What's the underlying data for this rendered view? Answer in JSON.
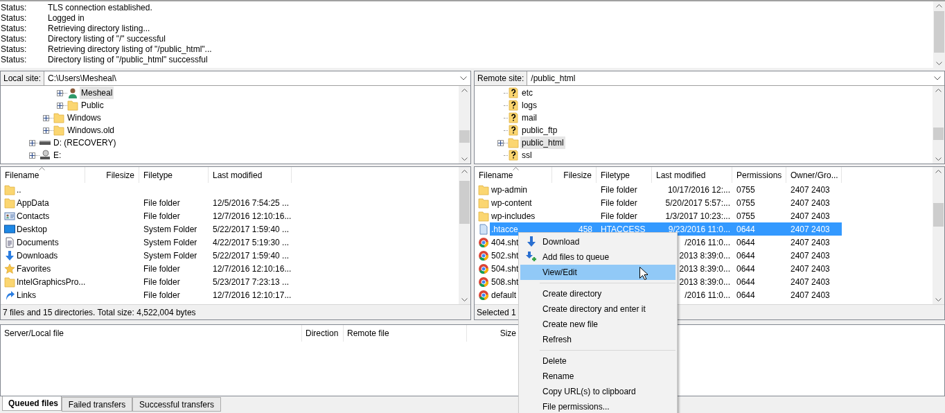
{
  "message_log": [
    {
      "label": "Status:",
      "message": "TLS connection established."
    },
    {
      "label": "Status:",
      "message": "Logged in"
    },
    {
      "label": "Status:",
      "message": "Retrieving directory listing..."
    },
    {
      "label": "Status:",
      "message": "Directory listing of \"/\" successful"
    },
    {
      "label": "Status:",
      "message": "Retrieving directory listing of \"/public_html\"..."
    },
    {
      "label": "Status:",
      "message": "Directory listing of \"/public_html\" successful"
    }
  ],
  "local": {
    "site_label": "Local site:",
    "path": "C:\\Users\\Mesheal\\",
    "tree": [
      {
        "children": [
          {
            "children": [
              {
                "label": "Mesheal",
                "kind": "user",
                "expandable": true,
                "expanded": false,
                "selected": true
              },
              {
                "label": "Public",
                "kind": "folder",
                "expandable": true,
                "expanded": false,
                "selected": false
              }
            ]
          },
          {
            "label": "Windows",
            "kind": "folder",
            "expandable": true,
            "expanded": false,
            "selected": false
          },
          {
            "label": "Windows.old",
            "kind": "folder",
            "expandable": true,
            "expanded": false,
            "selected": false
          }
        ]
      },
      {
        "label": "D: (RECOVERY)",
        "kind": "drive",
        "expandable": true,
        "expanded": false,
        "selected": false
      },
      {
        "label": "E:",
        "kind": "disc",
        "expandable": true,
        "expanded": false,
        "selected": false
      }
    ],
    "columns": [
      "Filename",
      "Filesize",
      "Filetype",
      "Last modified"
    ],
    "rows": [
      {
        "kind": "folder",
        "name": "..",
        "filetype": "",
        "modified": "",
        "selected": false
      },
      {
        "kind": "folder",
        "name": "AppData",
        "filetype": "File folder",
        "modified": "12/5/2016 7:54:25 ...",
        "selected": false
      },
      {
        "kind": "contacts",
        "name": "Contacts",
        "filetype": "File folder",
        "modified": "12/7/2016 12:10:16...",
        "selected": false
      },
      {
        "kind": "desktop",
        "name": "Desktop",
        "filetype": "System Folder",
        "modified": "5/22/2017 1:59:40 ...",
        "selected": false
      },
      {
        "kind": "documents",
        "name": "Documents",
        "filetype": "System Folder",
        "modified": "4/22/2017 5:19:30 ...",
        "selected": false
      },
      {
        "kind": "downloads",
        "name": "Downloads",
        "filetype": "System Folder",
        "modified": "5/22/2017 1:59:40 ...",
        "selected": false
      },
      {
        "kind": "favorites",
        "name": "Favorites",
        "filetype": "File folder",
        "modified": "12/7/2016 12:10:16...",
        "selected": false
      },
      {
        "kind": "folder",
        "name": "IntelGraphicsPro...",
        "filetype": "File folder",
        "modified": "5/23/2017 7:23:13 ...",
        "selected": false
      },
      {
        "kind": "links",
        "name": "Links",
        "filetype": "File folder",
        "modified": "12/7/2016 12:10:17...",
        "selected": false
      }
    ],
    "status": "7 files and 15 directories. Total size: 4,522,004 bytes"
  },
  "remote": {
    "site_label": "Remote site:",
    "path": "/public_html",
    "tree": [
      {
        "children": [
          {
            "label": "etc",
            "kind": "unknown",
            "expandable": false,
            "selected": false
          },
          {
            "label": "logs",
            "kind": "unknown",
            "expandable": false,
            "selected": false
          },
          {
            "label": "mail",
            "kind": "unknown",
            "expandable": false,
            "selected": false
          },
          {
            "label": "public_ftp",
            "kind": "unknown",
            "expandable": false,
            "selected": false
          },
          {
            "label": "public_html",
            "kind": "folder",
            "expandable": true,
            "expanded": false,
            "selected": true
          },
          {
            "label": "ssl",
            "kind": "unknown",
            "expandable": false,
            "selected": false
          }
        ]
      }
    ],
    "columns": [
      "Filename",
      "Filesize",
      "Filetype",
      "Last modified",
      "Permissions",
      "Owner/Gro..."
    ],
    "rows": [
      {
        "kind": "folder",
        "name": "wp-admin",
        "filesize": "",
        "filetype": "File folder",
        "modified": "10/17/2016 12:...",
        "permissions": "0755",
        "owner": "2407 2403",
        "selected": false
      },
      {
        "kind": "folder",
        "name": "wp-content",
        "filesize": "",
        "filetype": "File folder",
        "modified": "5/20/2017 5:57:...",
        "permissions": "0755",
        "owner": "2407 2403",
        "selected": false
      },
      {
        "kind": "folder",
        "name": "wp-includes",
        "filesize": "",
        "filetype": "File folder",
        "modified": "1/3/2017 10:23:...",
        "permissions": "0755",
        "owner": "2407 2403",
        "selected": false
      },
      {
        "kind": "file",
        "name": ".htacce",
        "filesize": "458",
        "filetype": "HTACCESS",
        "modified": "9/23/2016 11:0...",
        "permissions": "0644",
        "owner": "2407 2403",
        "selected": true
      },
      {
        "kind": "web",
        "name": "404.sht",
        "filesize": "",
        "filetype": "",
        "modified": "/2016 11:0...",
        "permissions": "0644",
        "owner": "2407 2403",
        "selected": false
      },
      {
        "kind": "web",
        "name": "502.sht",
        "filesize": "",
        "filetype": "",
        "modified": "2013 8:39:0...",
        "permissions": "0644",
        "owner": "2407 2403",
        "selected": false
      },
      {
        "kind": "web",
        "name": "504.sht",
        "filesize": "",
        "filetype": "",
        "modified": "2013 8:39:0...",
        "permissions": "0644",
        "owner": "2407 2403",
        "selected": false
      },
      {
        "kind": "web",
        "name": "508.sht",
        "filesize": "",
        "filetype": "",
        "modified": "2013 8:39:0...",
        "permissions": "0644",
        "owner": "2407 2403",
        "selected": false
      },
      {
        "kind": "web",
        "name": "default",
        "filesize": "",
        "filetype": "",
        "modified": "/2016 11:0...",
        "permissions": "0644",
        "owner": "2407 2403",
        "selected": false
      }
    ],
    "status": "Selected 1"
  },
  "queue": {
    "columns": [
      "Server/Local file",
      "Direction",
      "Remote file",
      "Size"
    ],
    "tabs": [
      {
        "label": "Queued files",
        "selected": true
      },
      {
        "label": "Failed transfers",
        "selected": false
      },
      {
        "label": "Successful transfers",
        "selected": false
      }
    ]
  },
  "context_menu": [
    [
      {
        "kind": "download",
        "label": "Download",
        "selected": false
      },
      {
        "kind": "enqueue",
        "label": "Add files to queue",
        "selected": false
      },
      {
        "kind": "plain",
        "label": "View/Edit",
        "selected": true
      }
    ],
    [
      {
        "kind": "plain",
        "label": "Create directory",
        "selected": false
      },
      {
        "kind": "plain",
        "label": "Create directory and enter it",
        "selected": false
      },
      {
        "kind": "plain",
        "label": "Create new file",
        "selected": false
      },
      {
        "kind": "plain",
        "label": "Refresh",
        "selected": false
      }
    ],
    [
      {
        "kind": "plain",
        "label": "Delete",
        "selected": false
      },
      {
        "kind": "plain",
        "label": "Rename",
        "selected": false
      },
      {
        "kind": "plain",
        "label": "Copy URL(s) to clipboard",
        "selected": false
      },
      {
        "kind": "plain",
        "label": "File permissions...",
        "selected": false
      }
    ]
  ]
}
